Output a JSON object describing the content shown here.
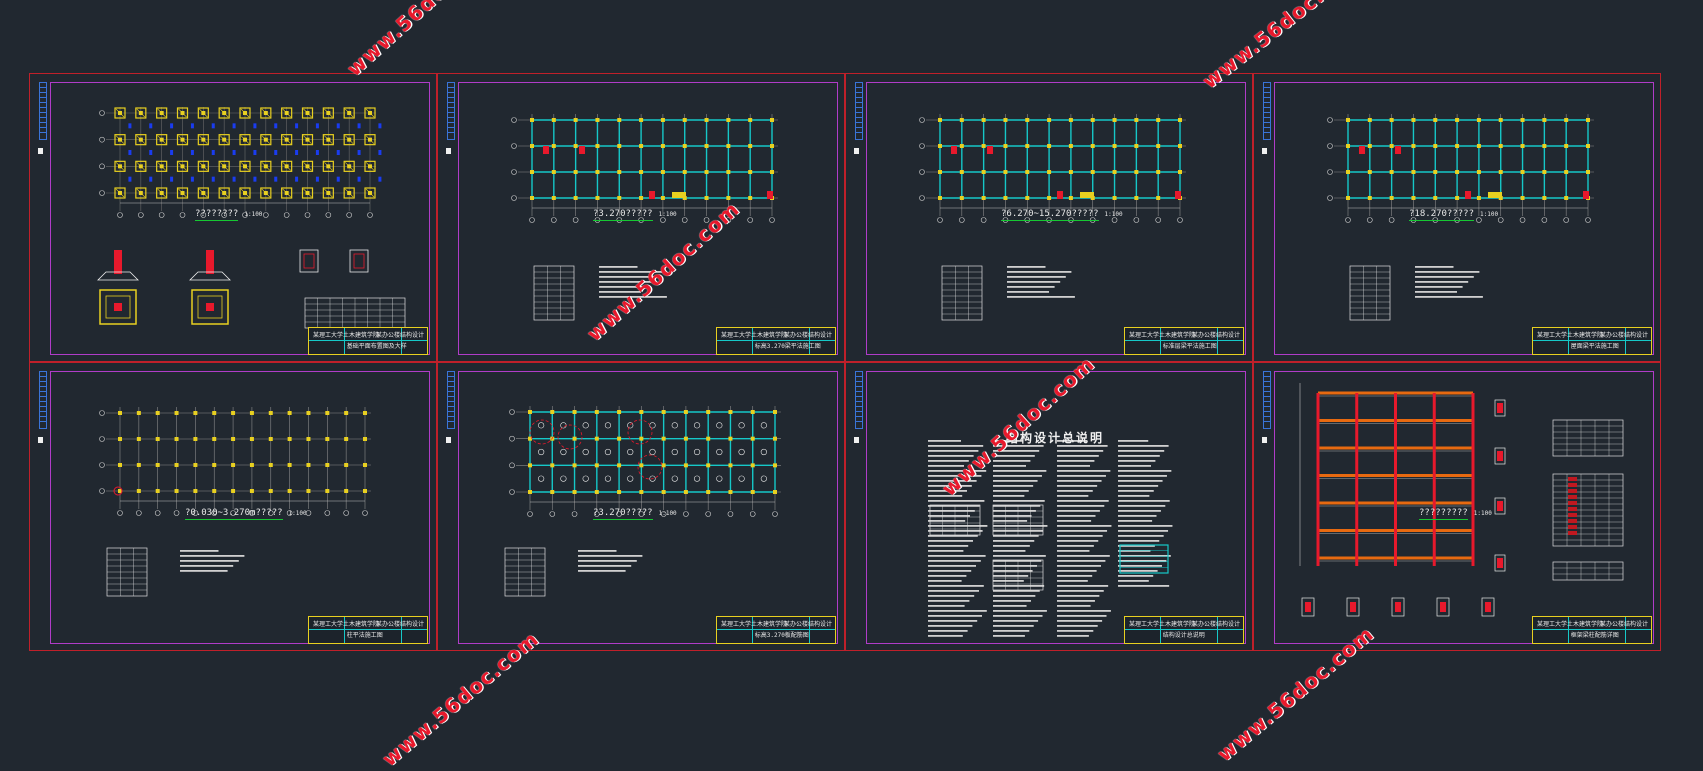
{
  "sheets": [
    {
      "caption": "????????",
      "scale": "1:100",
      "drawing_name": "基础平面布置图及大样"
    },
    {
      "caption": "?3.270?????",
      "scale": "1:100",
      "drawing_name": "标高3.270梁平法施工图"
    },
    {
      "caption": "?6.270~15.270?????",
      "scale": "1:100",
      "drawing_name": "标准层梁平法施工图"
    },
    {
      "caption": "?18.270?????",
      "scale": "1:100",
      "drawing_name": "屋面梁平法施工图"
    },
    {
      "caption": "?0.030~3.270m?????",
      "scale": "1:100",
      "drawing_name": "柱平法施工图"
    },
    {
      "caption": "?3.270?????",
      "scale": "1:100",
      "drawing_name": "标高3.270板配筋图"
    },
    {
      "caption": "",
      "scale": "",
      "heading": "结构设计总说明",
      "drawing_name": "结构设计总说明"
    },
    {
      "caption": "?????????",
      "scale": "1:100",
      "drawing_name": "框架梁柱配筋详图"
    }
  ],
  "title_block": {
    "school": "某理工大学土木建筑学院",
    "project": "某办公楼结构设计"
  },
  "watermark_text": "www.56doc.com",
  "colors": {
    "background": "#212830",
    "frame": "#c0202a",
    "border": "#b03cc8",
    "grid": "#16c8c8",
    "beam": "#e8d020",
    "underline": "#16c832",
    "watermark": "#e8192c"
  }
}
